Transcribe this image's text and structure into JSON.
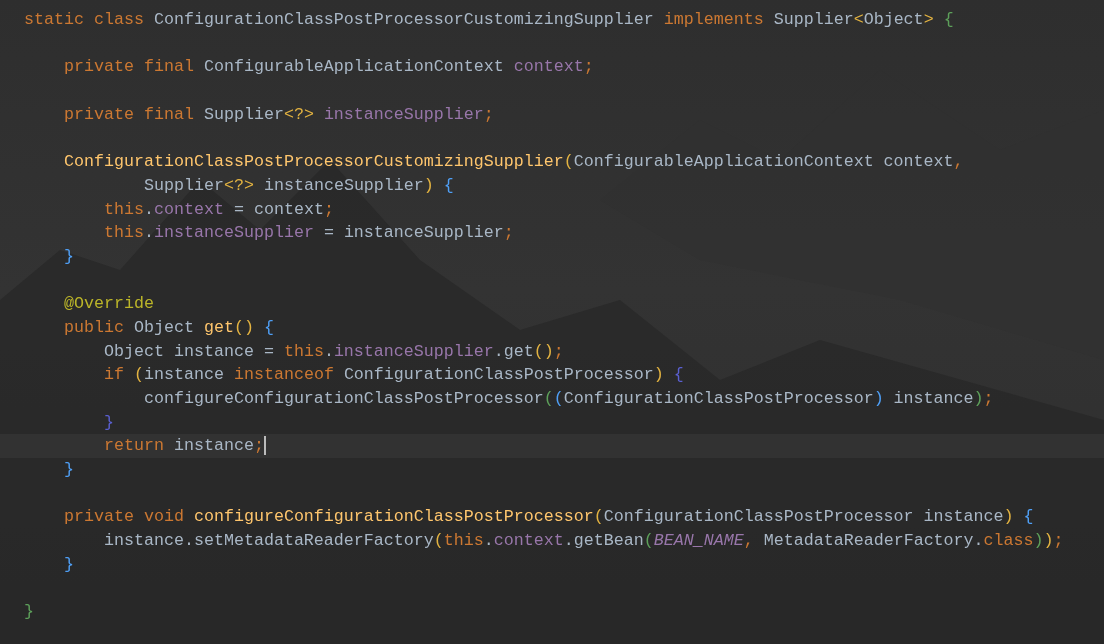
{
  "editor": {
    "lines": [
      {
        "kind": "code",
        "tokens": [
          {
            "kind": "kw",
            "text": "static class "
          },
          {
            "kind": "plain",
            "text": "ConfigurationClassPostProcessorCustomizingSupplier "
          },
          {
            "kind": "kw",
            "text": "implements "
          },
          {
            "kind": "plain",
            "text": "Supplier"
          },
          {
            "kind": "b1",
            "text": "<"
          },
          {
            "kind": "plain",
            "text": "Object"
          },
          {
            "kind": "b1",
            "text": "> "
          },
          {
            "kind": "b3",
            "text": "{"
          }
        ]
      },
      {
        "kind": "blank"
      },
      {
        "kind": "code",
        "tokens": [
          {
            "kind": "kw",
            "text": "    private final "
          },
          {
            "kind": "plain",
            "text": "ConfigurableApplicationContext "
          },
          {
            "kind": "field",
            "text": "context"
          },
          {
            "kind": "kw",
            "text": ";"
          }
        ]
      },
      {
        "kind": "blank"
      },
      {
        "kind": "code",
        "tokens": [
          {
            "kind": "kw",
            "text": "    private final "
          },
          {
            "kind": "plain",
            "text": "Supplier"
          },
          {
            "kind": "b1",
            "text": "<?> "
          },
          {
            "kind": "field",
            "text": "instanceSupplier"
          },
          {
            "kind": "kw",
            "text": ";"
          }
        ]
      },
      {
        "kind": "blank"
      },
      {
        "kind": "code",
        "tokens": [
          {
            "kind": "method",
            "text": "    ConfigurationClassPostProcessorCustomizingSupplier"
          },
          {
            "kind": "b1",
            "text": "("
          },
          {
            "kind": "plain",
            "text": "ConfigurableApplicationContext context"
          },
          {
            "kind": "kw",
            "text": ","
          }
        ]
      },
      {
        "kind": "code",
        "tokens": [
          {
            "kind": "plain",
            "text": "            Supplier"
          },
          {
            "kind": "b1",
            "text": "<?>"
          },
          {
            "kind": "plain",
            "text": " instanceSupplier"
          },
          {
            "kind": "b1",
            "text": ") "
          },
          {
            "kind": "b2",
            "text": "{"
          }
        ]
      },
      {
        "kind": "code",
        "tokens": [
          {
            "kind": "kw",
            "text": "        this"
          },
          {
            "kind": "plain",
            "text": "."
          },
          {
            "kind": "field",
            "text": "context"
          },
          {
            "kind": "plain",
            "text": " = context"
          },
          {
            "kind": "kw",
            "text": ";"
          }
        ]
      },
      {
        "kind": "code",
        "tokens": [
          {
            "kind": "kw",
            "text": "        this"
          },
          {
            "kind": "plain",
            "text": "."
          },
          {
            "kind": "field",
            "text": "instanceSupplier"
          },
          {
            "kind": "plain",
            "text": " = instanceSupplier"
          },
          {
            "kind": "kw",
            "text": ";"
          }
        ]
      },
      {
        "kind": "code",
        "tokens": [
          {
            "kind": "b2",
            "text": "    }"
          }
        ]
      },
      {
        "kind": "blank"
      },
      {
        "kind": "code",
        "tokens": [
          {
            "kind": "annotation",
            "text": "    @Override"
          }
        ]
      },
      {
        "kind": "code",
        "tokens": [
          {
            "kind": "kw",
            "text": "    public "
          },
          {
            "kind": "plain",
            "text": "Object "
          },
          {
            "kind": "method",
            "text": "get"
          },
          {
            "kind": "b1",
            "text": "() "
          },
          {
            "kind": "b2",
            "text": "{"
          }
        ]
      },
      {
        "kind": "code",
        "tokens": [
          {
            "kind": "plain",
            "text": "        Object instance = "
          },
          {
            "kind": "kw",
            "text": "this"
          },
          {
            "kind": "plain",
            "text": "."
          },
          {
            "kind": "field",
            "text": "instanceSupplier"
          },
          {
            "kind": "plain",
            "text": ".get"
          },
          {
            "kind": "b1",
            "text": "()"
          },
          {
            "kind": "kw",
            "text": ";"
          }
        ]
      },
      {
        "kind": "code",
        "tokens": [
          {
            "kind": "kw",
            "text": "        if "
          },
          {
            "kind": "b1",
            "text": "("
          },
          {
            "kind": "plain",
            "text": "instance "
          },
          {
            "kind": "kw",
            "text": "instanceof "
          },
          {
            "kind": "plain",
            "text": "ConfigurationClassPostProcessor"
          },
          {
            "kind": "b1",
            "text": ") "
          },
          {
            "kind": "b4",
            "text": "{"
          }
        ]
      },
      {
        "kind": "code",
        "tokens": [
          {
            "kind": "plain",
            "text": "            configureConfigurationClassPostProcessor"
          },
          {
            "kind": "b3",
            "text": "("
          },
          {
            "kind": "b2",
            "text": "("
          },
          {
            "kind": "plain",
            "text": "ConfigurationClassPostProcessor"
          },
          {
            "kind": "b2",
            "text": ")"
          },
          {
            "kind": "plain",
            "text": " instance"
          },
          {
            "kind": "b3",
            "text": ")"
          },
          {
            "kind": "kw",
            "text": ";"
          }
        ]
      },
      {
        "kind": "code",
        "tokens": [
          {
            "kind": "b4",
            "text": "        }"
          }
        ]
      },
      {
        "kind": "code",
        "current": true,
        "tokens": [
          {
            "kind": "kw",
            "text": "        return "
          },
          {
            "kind": "plain",
            "text": "instance"
          },
          {
            "kind": "kw",
            "text": ";"
          }
        ]
      },
      {
        "kind": "code",
        "tokens": [
          {
            "kind": "b2",
            "text": "    }"
          }
        ]
      },
      {
        "kind": "blank"
      },
      {
        "kind": "code",
        "tokens": [
          {
            "kind": "kw",
            "text": "    private void "
          },
          {
            "kind": "method",
            "text": "configureConfigurationClassPostProcessor"
          },
          {
            "kind": "b1",
            "text": "("
          },
          {
            "kind": "plain",
            "text": "ConfigurationClassPostProcessor instance"
          },
          {
            "kind": "b1",
            "text": ") "
          },
          {
            "kind": "b2",
            "text": "{"
          }
        ]
      },
      {
        "kind": "code",
        "tokens": [
          {
            "kind": "plain",
            "text": "        instance.setMetadataReaderFactory"
          },
          {
            "kind": "b1",
            "text": "("
          },
          {
            "kind": "kw",
            "text": "this"
          },
          {
            "kind": "plain",
            "text": "."
          },
          {
            "kind": "field",
            "text": "context"
          },
          {
            "kind": "plain",
            "text": ".getBean"
          },
          {
            "kind": "b3",
            "text": "("
          },
          {
            "kind": "constant",
            "text": "BEAN_NAME"
          },
          {
            "kind": "kw",
            "text": ", "
          },
          {
            "kind": "plain",
            "text": "MetadataReaderFactory."
          },
          {
            "kind": "kw",
            "text": "class"
          },
          {
            "kind": "b3",
            "text": ")"
          },
          {
            "kind": "b1",
            "text": ")"
          },
          {
            "kind": "kw",
            "text": ";"
          }
        ]
      },
      {
        "kind": "code",
        "tokens": [
          {
            "kind": "b2",
            "text": "    }"
          }
        ]
      },
      {
        "kind": "blank"
      },
      {
        "kind": "code",
        "tokens": [
          {
            "kind": "b3",
            "text": "}"
          }
        ]
      }
    ]
  }
}
